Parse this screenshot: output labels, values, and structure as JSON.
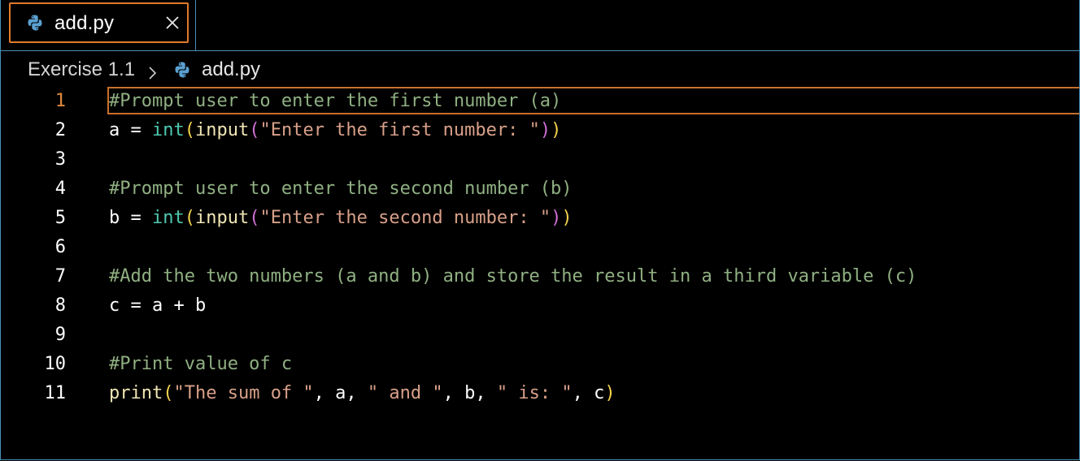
{
  "tab": {
    "title": "add.py",
    "icon": "python-file-icon",
    "close_icon": "close-icon"
  },
  "breadcrumb": {
    "folder": "Exercise 1.1",
    "separator_icon": "chevron-right-icon",
    "file_icon": "python-file-icon",
    "file": "add.py"
  },
  "editor": {
    "language": "python",
    "active_line": 1,
    "lines": [
      {
        "number": "1",
        "tokens": [
          {
            "type": "comment",
            "text": "#Prompt user to enter the first number (a)"
          }
        ]
      },
      {
        "number": "2",
        "tokens": [
          {
            "type": "plain",
            "text": "a = "
          },
          {
            "type": "builtin",
            "text": "int"
          },
          {
            "type": "paren1",
            "text": "("
          },
          {
            "type": "func",
            "text": "input"
          },
          {
            "type": "paren2",
            "text": "("
          },
          {
            "type": "string",
            "text": "\"Enter the first number: \""
          },
          {
            "type": "paren2",
            "text": ")"
          },
          {
            "type": "paren1",
            "text": ")"
          }
        ]
      },
      {
        "number": "3",
        "tokens": []
      },
      {
        "number": "4",
        "tokens": [
          {
            "type": "comment",
            "text": "#Prompt user to enter the second number (b)"
          }
        ]
      },
      {
        "number": "5",
        "tokens": [
          {
            "type": "plain",
            "text": "b = "
          },
          {
            "type": "builtin",
            "text": "int"
          },
          {
            "type": "paren1",
            "text": "("
          },
          {
            "type": "func",
            "text": "input"
          },
          {
            "type": "paren2",
            "text": "("
          },
          {
            "type": "string",
            "text": "\"Enter the second number: \""
          },
          {
            "type": "paren2",
            "text": ")"
          },
          {
            "type": "paren1",
            "text": ")"
          }
        ]
      },
      {
        "number": "6",
        "tokens": []
      },
      {
        "number": "7",
        "tokens": [
          {
            "type": "comment",
            "text": "#Add the two numbers (a and b) and store the result in a third variable (c)"
          }
        ]
      },
      {
        "number": "8",
        "tokens": [
          {
            "type": "plain",
            "text": "c = a + b"
          }
        ]
      },
      {
        "number": "9",
        "tokens": []
      },
      {
        "number": "10",
        "tokens": [
          {
            "type": "comment",
            "text": "#Print value of c"
          }
        ]
      },
      {
        "number": "11",
        "tokens": [
          {
            "type": "func",
            "text": "print"
          },
          {
            "type": "paren1",
            "text": "("
          },
          {
            "type": "string",
            "text": "\"The sum of \""
          },
          {
            "type": "plain",
            "text": ", a, "
          },
          {
            "type": "string",
            "text": "\" and \""
          },
          {
            "type": "plain",
            "text": ", b, "
          },
          {
            "type": "string",
            "text": "\" is: \""
          },
          {
            "type": "plain",
            "text": ", c"
          },
          {
            "type": "paren1",
            "text": ")"
          }
        ]
      }
    ]
  },
  "colors": {
    "background": "#000000",
    "border": "#4a90b8",
    "active_tab_outline": "#e07a2b",
    "comment": "#8fb082",
    "builtin": "#4ec9b0",
    "function": "#f0e6b4",
    "string": "#d9a089",
    "bracket_level1": "#f5d34c",
    "bracket_level2": "#d070d6",
    "active_line_number": "#e0893a"
  }
}
